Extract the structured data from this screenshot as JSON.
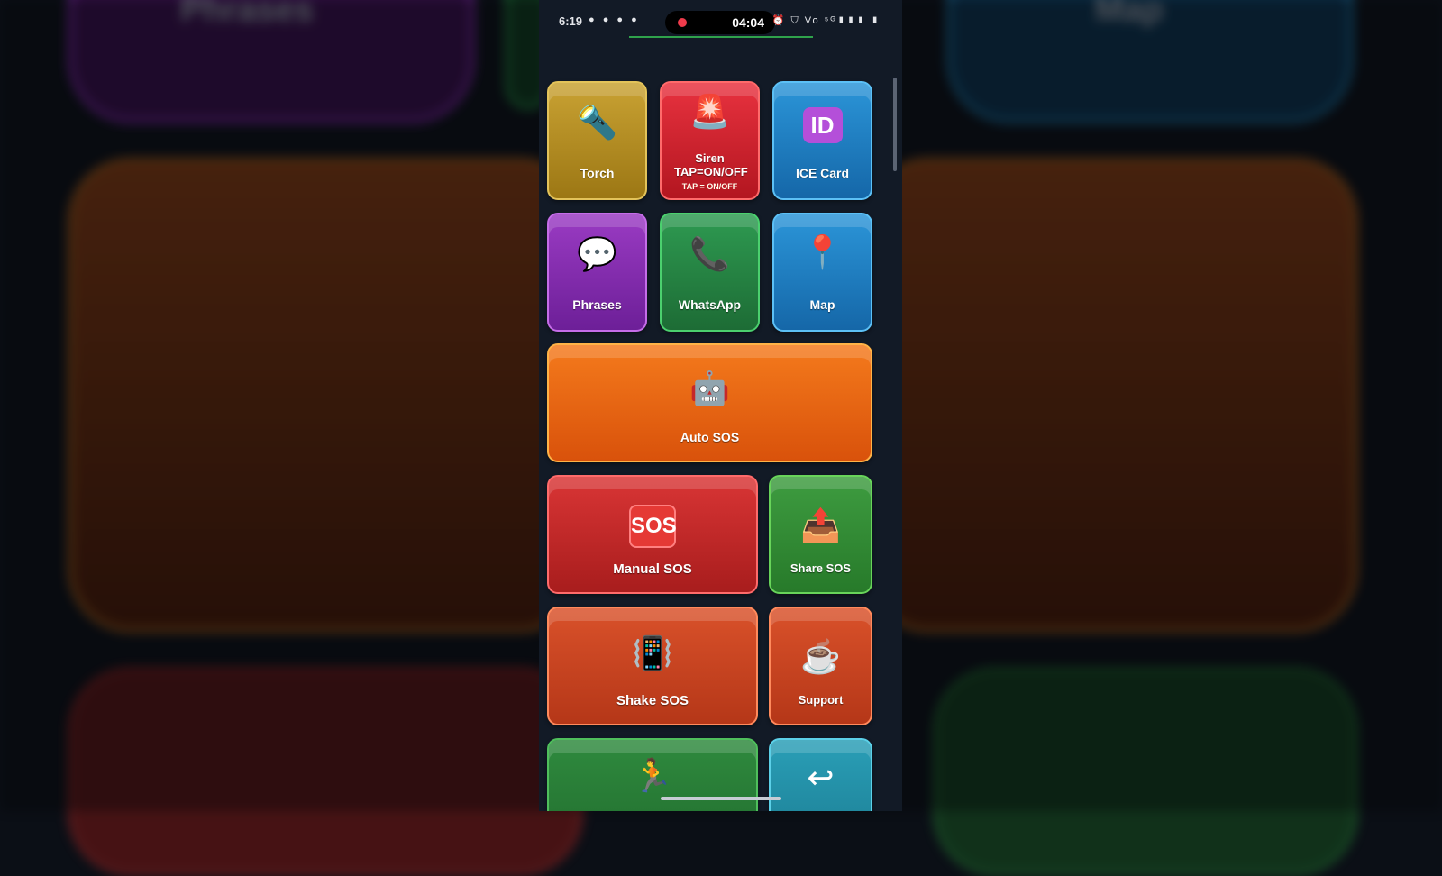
{
  "background": {
    "labels": [
      "Phrases",
      "Map"
    ]
  },
  "status_bar": {
    "time": "6:19",
    "notification_icons": "● ● ● ●",
    "recording_time": "04:04",
    "system_icons": "⏰ ⛉ Vo ⁵ᴳ▮▮▮ ▮"
  },
  "tiles": {
    "torch": {
      "icon": "🔦",
      "label": "Torch"
    },
    "siren": {
      "icon": "🚨",
      "label": "Siren TAP=ON/OFF",
      "sublabel": "TAP = ON/OFF"
    },
    "ice_card": {
      "icon": "ID",
      "label": "ICE Card"
    },
    "phrases": {
      "icon": "💬",
      "label": "Phrases"
    },
    "whatsapp": {
      "icon": "📞",
      "label": "WhatsApp"
    },
    "map": {
      "icon": "📍",
      "label": "Map"
    },
    "auto_sos": {
      "icon": "🤖",
      "label": "Auto SOS"
    },
    "manual_sos": {
      "icon": "SOS",
      "label": "Manual SOS"
    },
    "share_sos": {
      "icon": "📤",
      "label": "Share SOS"
    },
    "shake_sos": {
      "icon": "📳",
      "label": "Shake SOS"
    },
    "support": {
      "icon": "☕",
      "label": "Support"
    },
    "walk": {
      "icon": "🏃"
    },
    "back": {
      "icon": "↩"
    }
  },
  "colors": {
    "torch": "#c9a233",
    "siren": "#e8323f",
    "ice_card": "#2b95d8",
    "phrases": "#9a3bc3",
    "whatsapp": "#2e9a51",
    "map": "#2b95d8",
    "auto_sos": "#f47a1c",
    "manual_sos": "#d93535",
    "share_sos": "#3e9c40",
    "shake_sos": "#d9512a",
    "support": "#d9512a",
    "record": "#ef3b4b"
  }
}
